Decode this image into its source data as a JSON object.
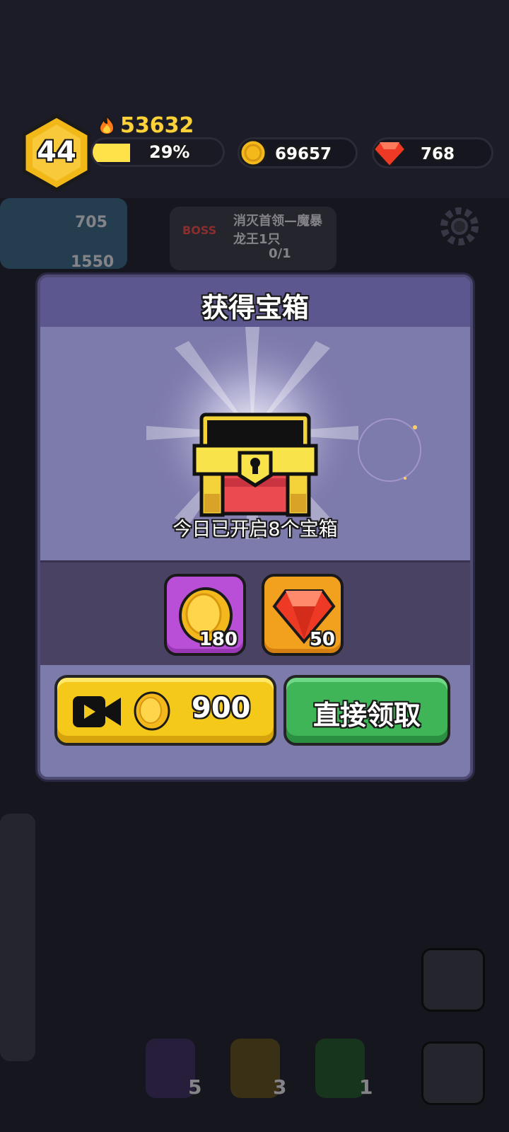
{
  "hud": {
    "level": "44",
    "power": "53632",
    "xp_percent_text": "29%",
    "xp_fraction": 0.29,
    "coins": "69657",
    "gems": "768"
  },
  "background": {
    "meat": "705",
    "wood": "1550",
    "quest_text": "消灭首领—魔暴龙王1只",
    "quest_progress": "0/1",
    "boss_label": "BOSS",
    "book1_count": "5",
    "book2_count": "3",
    "book3_count": "1"
  },
  "dialog": {
    "title": "获得宝箱",
    "opened_text": "今日已开启8个宝箱",
    "rewards": [
      {
        "icon": "coin-icon",
        "amount": "180",
        "bg": "#b94fd6"
      },
      {
        "icon": "gem-icon",
        "amount": "50",
        "bg": "#f2a11e"
      }
    ],
    "video_button_price": "900",
    "claim_button_label": "直接领取"
  },
  "colors": {
    "dialog_bg": "#7d7aac",
    "header_bg": "#5d578f",
    "reward_band": "#4a4262",
    "yellow_button": "#f4c91a",
    "green_button": "#3fb558",
    "power_text": "#ffd23a"
  }
}
